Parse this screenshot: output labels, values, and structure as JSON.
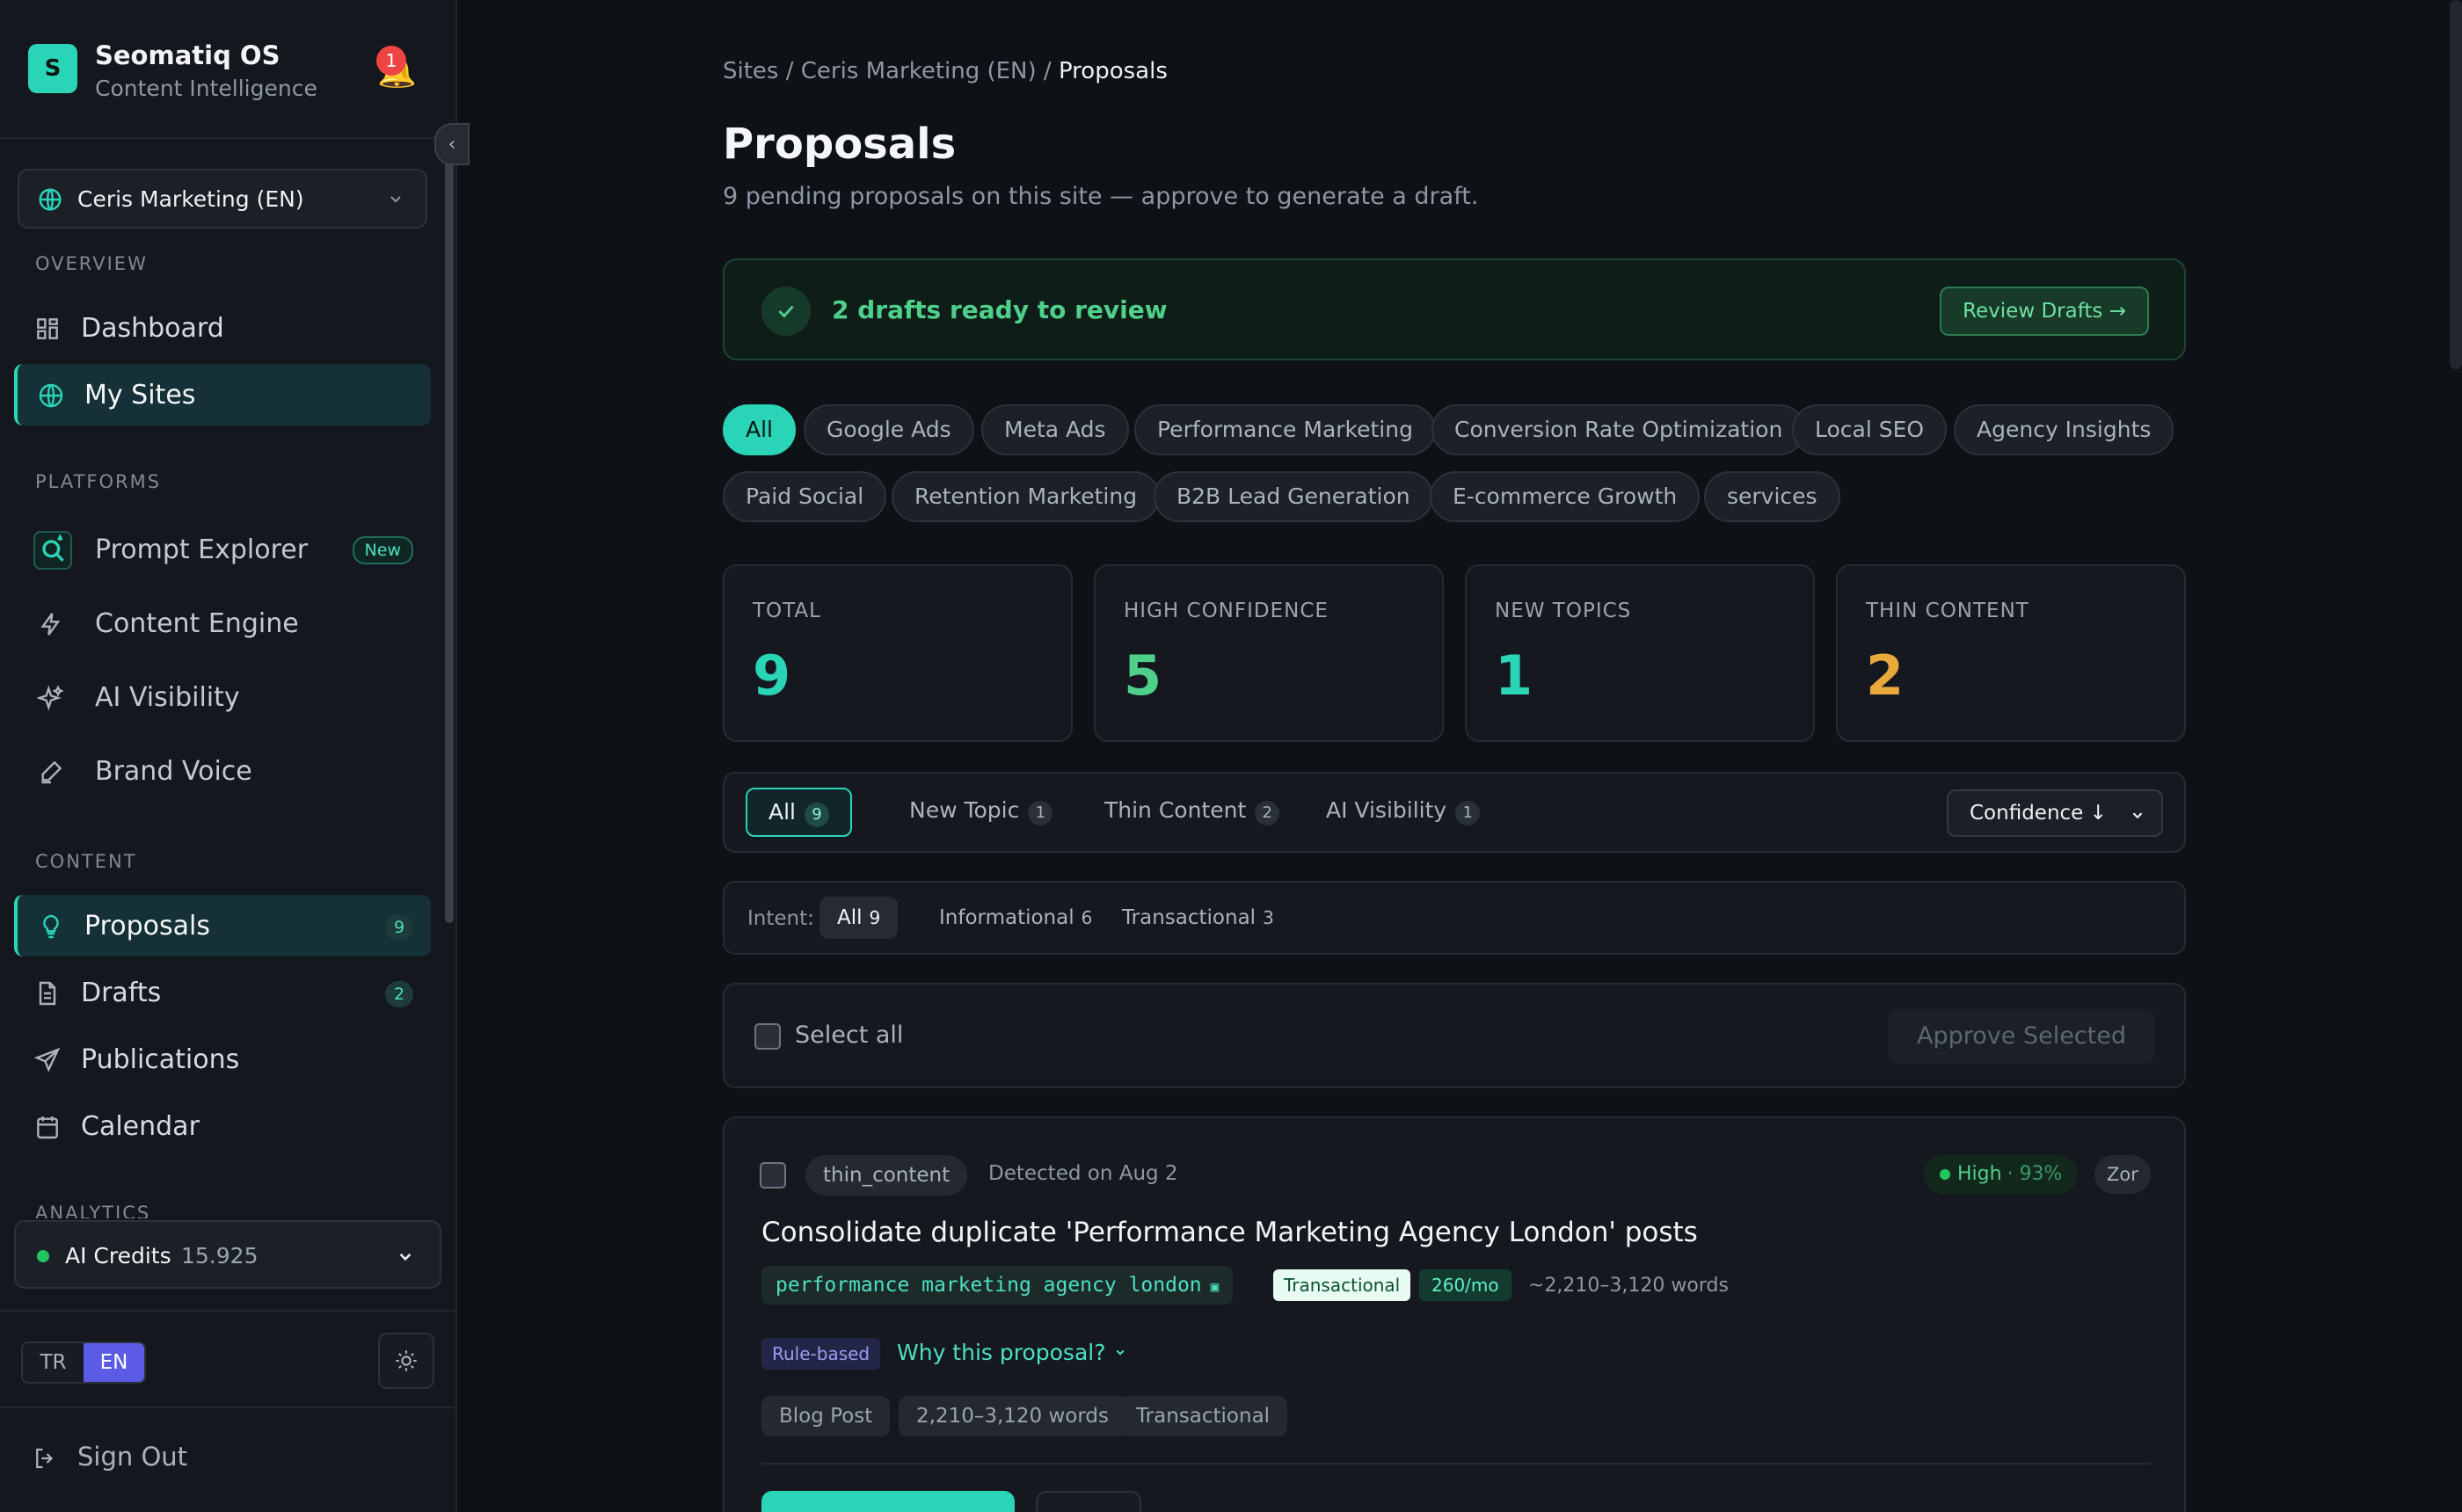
{
  "app": {
    "name": "Seomatiq OS",
    "subtitle": "Content Intelligence",
    "logo_letter": "S",
    "notifications": "1"
  },
  "site_selector": {
    "label": "Ceris Marketing (EN)"
  },
  "sidebar": {
    "overview_label": "OVERVIEW",
    "overview": [
      {
        "label": "Dashboard"
      },
      {
        "label": "My Sites"
      }
    ],
    "platforms_label": "PLATFORMS",
    "platforms": [
      {
        "label": "Prompt Explorer",
        "badge": "New"
      },
      {
        "label": "Content Engine"
      },
      {
        "label": "AI Visibility"
      },
      {
        "label": "Brand Voice"
      }
    ],
    "content_label": "CONTENT",
    "content": [
      {
        "label": "Proposals",
        "count": "9"
      },
      {
        "label": "Drafts",
        "count": "2"
      },
      {
        "label": "Publications"
      },
      {
        "label": "Calendar"
      }
    ],
    "analytics_label": "ANALYTICS"
  },
  "credits": {
    "label": "AI Credits",
    "value": "15.925"
  },
  "language": {
    "tr": "TR",
    "en": "EN"
  },
  "signout": {
    "label": "Sign Out"
  },
  "breadcrumb": {
    "sites": "Sites",
    "site": "Ceris Marketing (EN)",
    "current": "Proposals",
    "sep": "/"
  },
  "page": {
    "title": "Proposals",
    "subtitle": "9 pending proposals on this site — approve to generate a draft."
  },
  "banner": {
    "text": "2 drafts ready to review",
    "button": "Review Drafts →"
  },
  "categories": [
    "All",
    "Google Ads",
    "Meta Ads",
    "Performance Marketing",
    "Conversion Rate Optimization",
    "Local SEO",
    "Agency Insights",
    "Paid Social",
    "Retention Marketing",
    "B2B Lead Generation",
    "E-commerce Growth",
    "services"
  ],
  "stats": [
    {
      "label": "TOTAL",
      "value": "9",
      "color": "#2ad4b6"
    },
    {
      "label": "HIGH CONFIDENCE",
      "value": "5",
      "color": "#4fd08a"
    },
    {
      "label": "NEW TOPICS",
      "value": "1",
      "color": "#2ad4b6"
    },
    {
      "label": "THIN CONTENT",
      "value": "2",
      "color": "#e8a93a"
    }
  ],
  "filter_tabs": [
    {
      "label": "All",
      "count": "9"
    },
    {
      "label": "New Topic",
      "count": "1"
    },
    {
      "label": "Thin Content",
      "count": "2"
    },
    {
      "label": "AI Visibility",
      "count": "1"
    }
  ],
  "sort": {
    "label": "Confidence ↓"
  },
  "intent": {
    "label": "Intent:",
    "options": [
      {
        "label": "All",
        "count": "9"
      },
      {
        "label": "Informational",
        "count": "6"
      },
      {
        "label": "Transactional",
        "count": "3"
      }
    ]
  },
  "select_bar": {
    "select_all": "Select all",
    "approve": "Approve Selected"
  },
  "proposal": {
    "type": "thin_content",
    "detected": "Detected on Aug 2",
    "confidence_level": "High",
    "confidence_pct": "· 93%",
    "extra_tag": "Zor",
    "title": "Consolidate duplicate 'Performance Marketing Agency London' posts",
    "keyword": "performance marketing agency london",
    "intent": "Transactional",
    "volume": "260/mo",
    "words": "~2,210–3,120 words",
    "source": "Rule-based",
    "why": "Why this proposal?",
    "meta": [
      "Blog Post",
      "2,210–3,120 words",
      "Transactional"
    ]
  },
  "colors": {
    "accent": "#2ad4b6",
    "success": "#4fd08a",
    "warning": "#e8a93a",
    "background": "#0e1116"
  }
}
